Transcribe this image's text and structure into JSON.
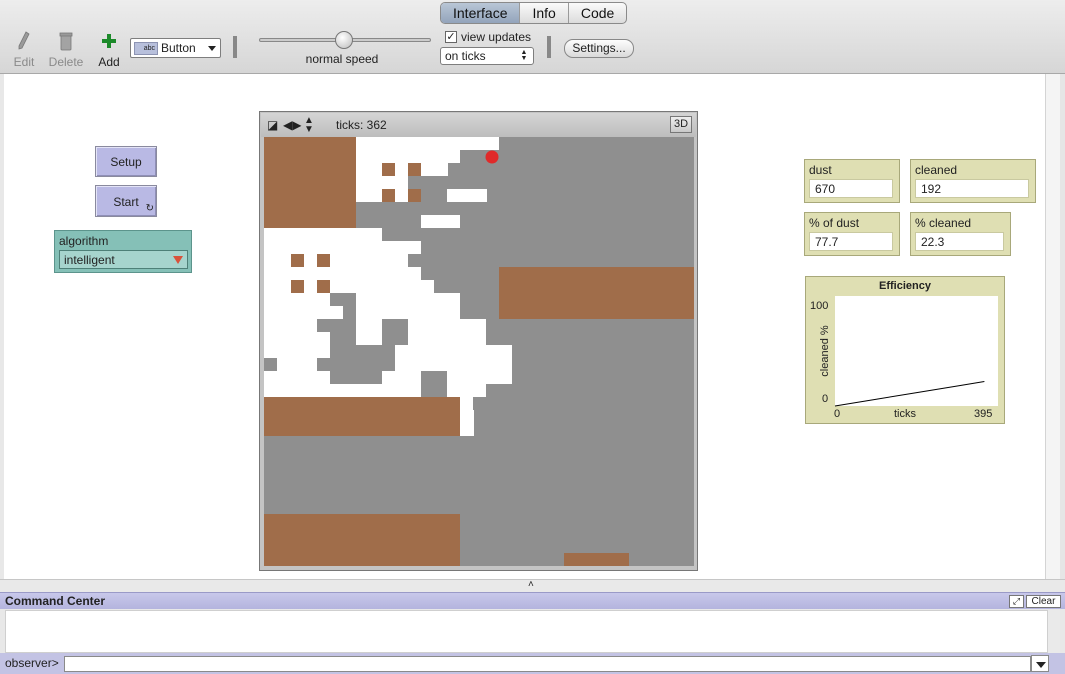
{
  "tabs": [
    {
      "label": "Interface",
      "active": true
    },
    {
      "label": "Info",
      "active": false
    },
    {
      "label": "Code",
      "active": false
    }
  ],
  "toolbar": {
    "edit_label": "Edit",
    "delete_label": "Delete",
    "add_label": "Add",
    "widget_type": "Button",
    "widget_icon_text": "abc",
    "speed_label": "normal speed",
    "speed_level": 0.5,
    "view_updates_label": "view updates",
    "view_updates_checked": true,
    "update_mode": "on ticks",
    "settings_label": "Settings..."
  },
  "interface": {
    "setup_button": "Setup",
    "start_button": "Start",
    "chooser": {
      "label": "algorithm",
      "value": "intelligent"
    },
    "view": {
      "ticks_text": "ticks: 362",
      "three_d": "3D"
    },
    "monitors": {
      "dust": {
        "label": "dust",
        "value": "670"
      },
      "cleaned": {
        "label": "cleaned",
        "value": "192"
      },
      "pct_dust": {
        "label": "% of dust",
        "value": "77.7"
      },
      "pct_cleaned": {
        "label": "% cleaned",
        "value": "22.3"
      }
    },
    "plot": {
      "title": "Efficiency",
      "ylabel": "cleaned %",
      "xlabel": "ticks",
      "ymax": "100",
      "ymin": "0",
      "xmin": "0",
      "xmax": "395"
    }
  },
  "chart_data": {
    "type": "line",
    "title": "Efficiency",
    "xlabel": "ticks",
    "ylabel": "cleaned %",
    "xlim": [
      0,
      395
    ],
    "ylim": [
      0,
      100
    ],
    "series": [
      {
        "name": "",
        "x": [
          0,
          100,
          200,
          300,
          362
        ],
        "y": [
          0,
          6.2,
          12.3,
          18.5,
          22.3
        ]
      }
    ]
  },
  "command_center": {
    "title": "Command Center",
    "clear_label": "Clear",
    "prompt": "observer>",
    "input_value": ""
  },
  "colors": {
    "button_bg": "#b9b9e4",
    "chooser_bg": "#85c0b7",
    "monitor_bg": "#dfdfb3",
    "dirt": "#8f8f8f",
    "clean": "#ffffff",
    "obstacle": "#a06d4a",
    "robot": "#e02a2a"
  }
}
